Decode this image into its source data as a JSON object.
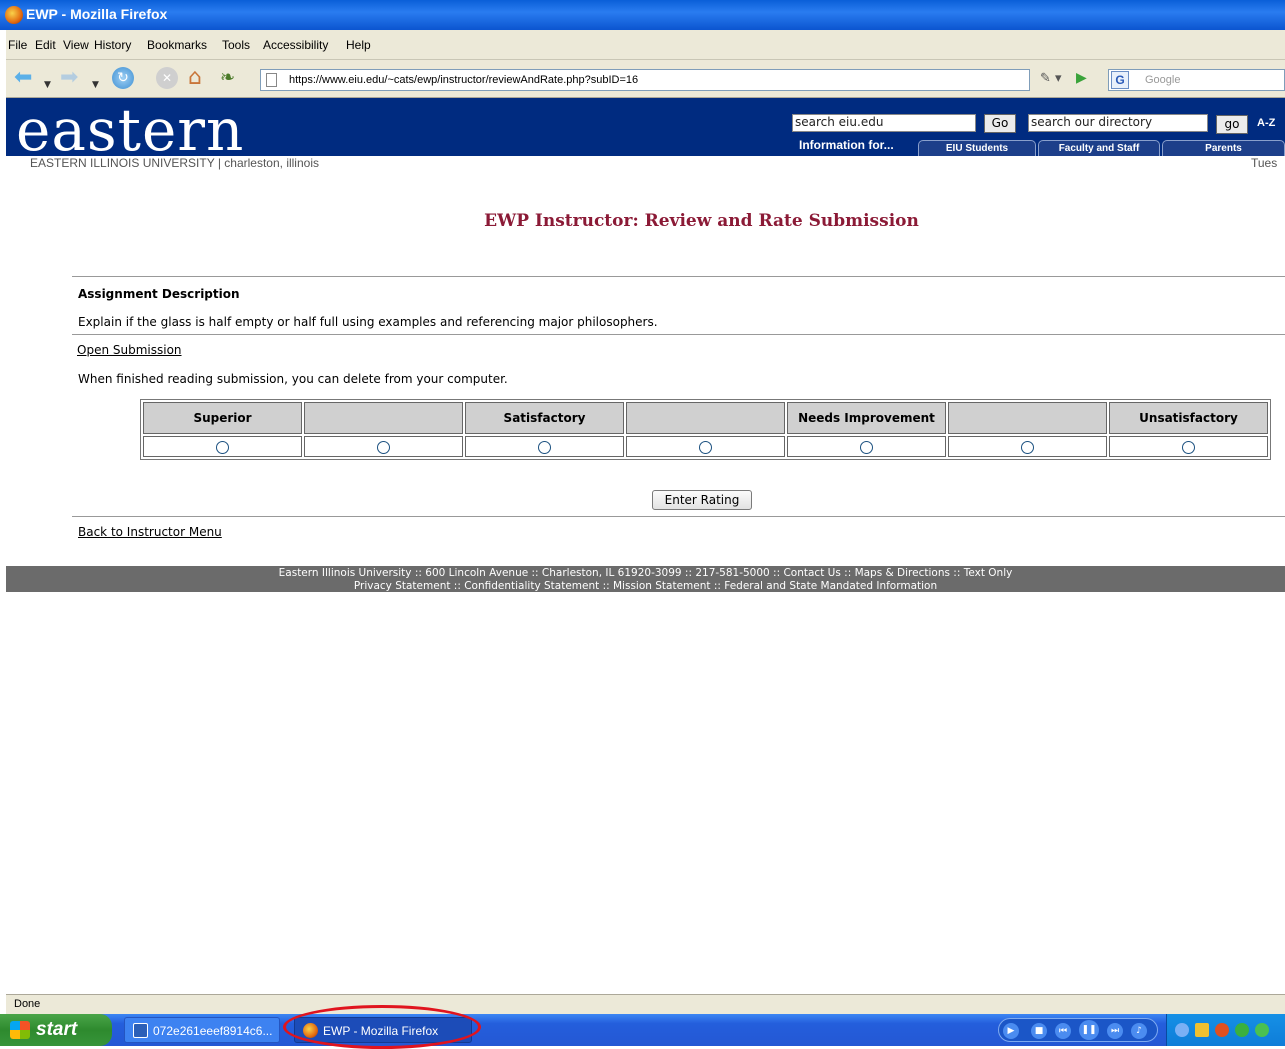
{
  "window": {
    "title": "EWP - Mozilla Firefox"
  },
  "menu": [
    "File",
    "Edit",
    "View",
    "History",
    "Bookmarks",
    "Tools",
    "Accessibility",
    "Help"
  ],
  "toolbar": {
    "url": "https://www.eiu.edu/~cats/ewp/instructor/reviewAndRate.php?subID=16",
    "search_placeholder": "Google"
  },
  "site": {
    "logo": "eastern",
    "subtitle": "EASTERN ILLINOIS UNIVERSITY | charleston, illinois",
    "date": "Tues",
    "search_value": "search eiu.edu",
    "go_label": "Go",
    "directory_value": "search our directory",
    "go2_label": "go",
    "az_label": "A-Z",
    "info_for": "Information for...",
    "tabs": [
      "EIU Students",
      "Faculty and Staff",
      "Parents"
    ]
  },
  "page": {
    "title": "EWP Instructor: Review and Rate Submission",
    "assignment_heading": "Assignment Description",
    "assignment_text": "Explain if the glass is half empty or half full using examples and referencing major philosophers.",
    "open_link": "Open Submission",
    "delete_note": "When finished reading submission, you can delete from your computer.",
    "rating_columns": [
      "Superior",
      "",
      "Satisfactory",
      "",
      "Needs Improvement",
      "",
      "Unsatisfactory"
    ],
    "enter_button": "Enter Rating",
    "back_link": "Back to Instructor Menu"
  },
  "footer": {
    "line1": "Eastern Illinois University :: 600 Lincoln Avenue :: Charleston, IL 61920-3099 :: 217-581-5000 :: Contact Us :: Maps & Directions :: Text Only",
    "line2": "Privacy Statement :: Confidentiality Statement :: Mission Statement :: Federal and State Mandated Information"
  },
  "status": {
    "text": "Done"
  },
  "taskbar": {
    "start_label": "start",
    "items": [
      "072e261eeef8914c6...",
      "EWP - Mozilla Firefox"
    ]
  },
  "colors": {
    "title_red": "#8b1a36",
    "banner_blue": "#002b80",
    "footer_gray": "#6b6b6b",
    "highlight_circle": "#e0141e"
  }
}
